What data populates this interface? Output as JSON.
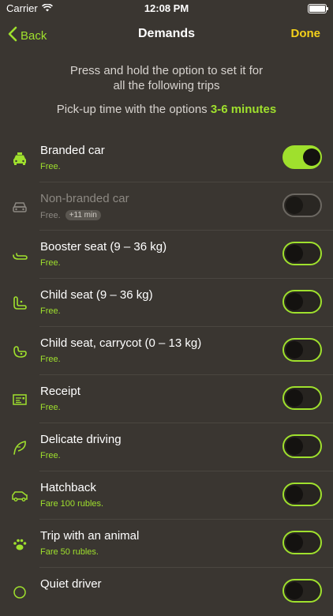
{
  "status_bar": {
    "carrier": "Carrier",
    "time": "12:08 PM"
  },
  "nav": {
    "back_label": "Back",
    "title": "Demands",
    "done_label": "Done"
  },
  "hint": {
    "line1": "Press and hold the option to set it for",
    "line2": "all the following trips"
  },
  "pickup": {
    "prefix": "Pick-up time with the options",
    "value": "3-6 minutes"
  },
  "colors": {
    "accent": "#9fe02d",
    "done": "#f4d11a",
    "background": "#3a3631"
  },
  "options": [
    {
      "icon": "taxi-icon",
      "title": "Branded car",
      "subtitle": "Free.",
      "on": true,
      "disabled": false
    },
    {
      "icon": "car-icon",
      "title": "Non-branded car",
      "subtitle": "Free.",
      "badge": "+11 min",
      "on": false,
      "disabled": true
    },
    {
      "icon": "booster-seat-icon",
      "title": "Booster seat (9 – 36 kg)",
      "subtitle": "Free.",
      "on": false,
      "disabled": false
    },
    {
      "icon": "child-seat-icon",
      "title": "Child seat (9 – 36 kg)",
      "subtitle": "Free.",
      "on": false,
      "disabled": false
    },
    {
      "icon": "carrycot-icon",
      "title": "Child seat, carrycot (0 – 13 kg)",
      "subtitle": "Free.",
      "on": false,
      "disabled": false
    },
    {
      "icon": "receipt-icon",
      "title": "Receipt",
      "subtitle": "Free.",
      "on": false,
      "disabled": false
    },
    {
      "icon": "feather-icon",
      "title": "Delicate driving",
      "subtitle": "Free.",
      "on": false,
      "disabled": false
    },
    {
      "icon": "hatchback-icon",
      "title": "Hatchback",
      "subtitle": "Fare 100 rubles.",
      "on": false,
      "disabled": false
    },
    {
      "icon": "paw-icon",
      "title": "Trip with an animal",
      "subtitle": "Fare 50 rubles.",
      "on": false,
      "disabled": false
    },
    {
      "icon": "quiet-icon",
      "title": "Quiet driver",
      "subtitle": "",
      "on": false,
      "disabled": false
    }
  ]
}
